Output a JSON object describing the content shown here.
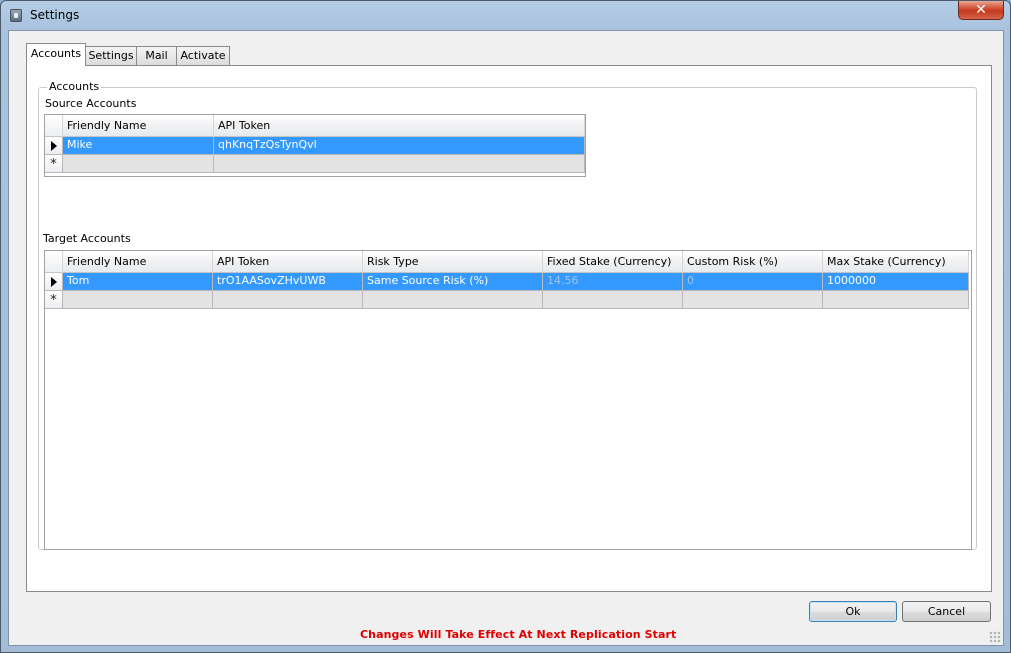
{
  "window": {
    "title": "Settings",
    "close_label": "✕"
  },
  "tabs": [
    {
      "label": "Accounts",
      "active": true
    },
    {
      "label": "Settings",
      "active": false
    },
    {
      "label": "Mail",
      "active": false
    },
    {
      "label": "Activate",
      "active": false
    }
  ],
  "accounts_group": {
    "title": "Accounts",
    "source": {
      "label": "Source Accounts",
      "columns": [
        "Friendly Name",
        "API Token"
      ],
      "rows": [
        {
          "friendly_name": "Mike",
          "api_token": "qhKnqTzQsTynQvl",
          "selected": true
        }
      ],
      "new_row_marker": "*"
    },
    "target": {
      "label": "Target Accounts",
      "columns": [
        "Friendly Name",
        "API Token",
        "Risk Type",
        "Fixed Stake (Currency)",
        "Custom Risk (%)",
        "Max Stake (Currency)"
      ],
      "rows": [
        {
          "friendly_name": "Tom",
          "api_token": "trO1AASovZHvUWB",
          "risk_type": "Same Source Risk (%)",
          "fixed_stake": "14.56",
          "custom_risk": "0",
          "max_stake": "1000000",
          "selected": true
        }
      ],
      "new_row_marker": "*"
    }
  },
  "buttons": {
    "ok": "Ok",
    "cancel": "Cancel"
  },
  "notice": "Changes Will Take Effect At Next Replication Start",
  "colors": {
    "selection": "#3399ff",
    "notice": "#e00000"
  }
}
